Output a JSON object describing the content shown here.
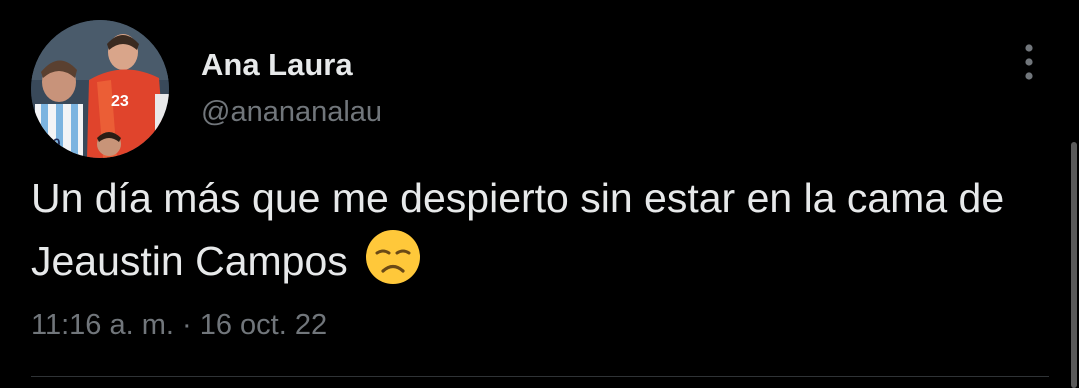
{
  "tweet": {
    "author": {
      "display_name": "Ana Laura",
      "handle": "@anananalau",
      "avatar_icon": "profile-photo"
    },
    "text": "Un día más que me despierto sin estar en la cama de Jeaustin Campos",
    "emoji": "disappointed-face",
    "timestamp": "11:16 a. m. · 16 oct. 22",
    "more_icon": "more-vertical-icon"
  },
  "colors": {
    "background": "#000000",
    "primary_text": "#e7e9ea",
    "secondary_text": "#71767b",
    "divider": "#2f3336"
  }
}
